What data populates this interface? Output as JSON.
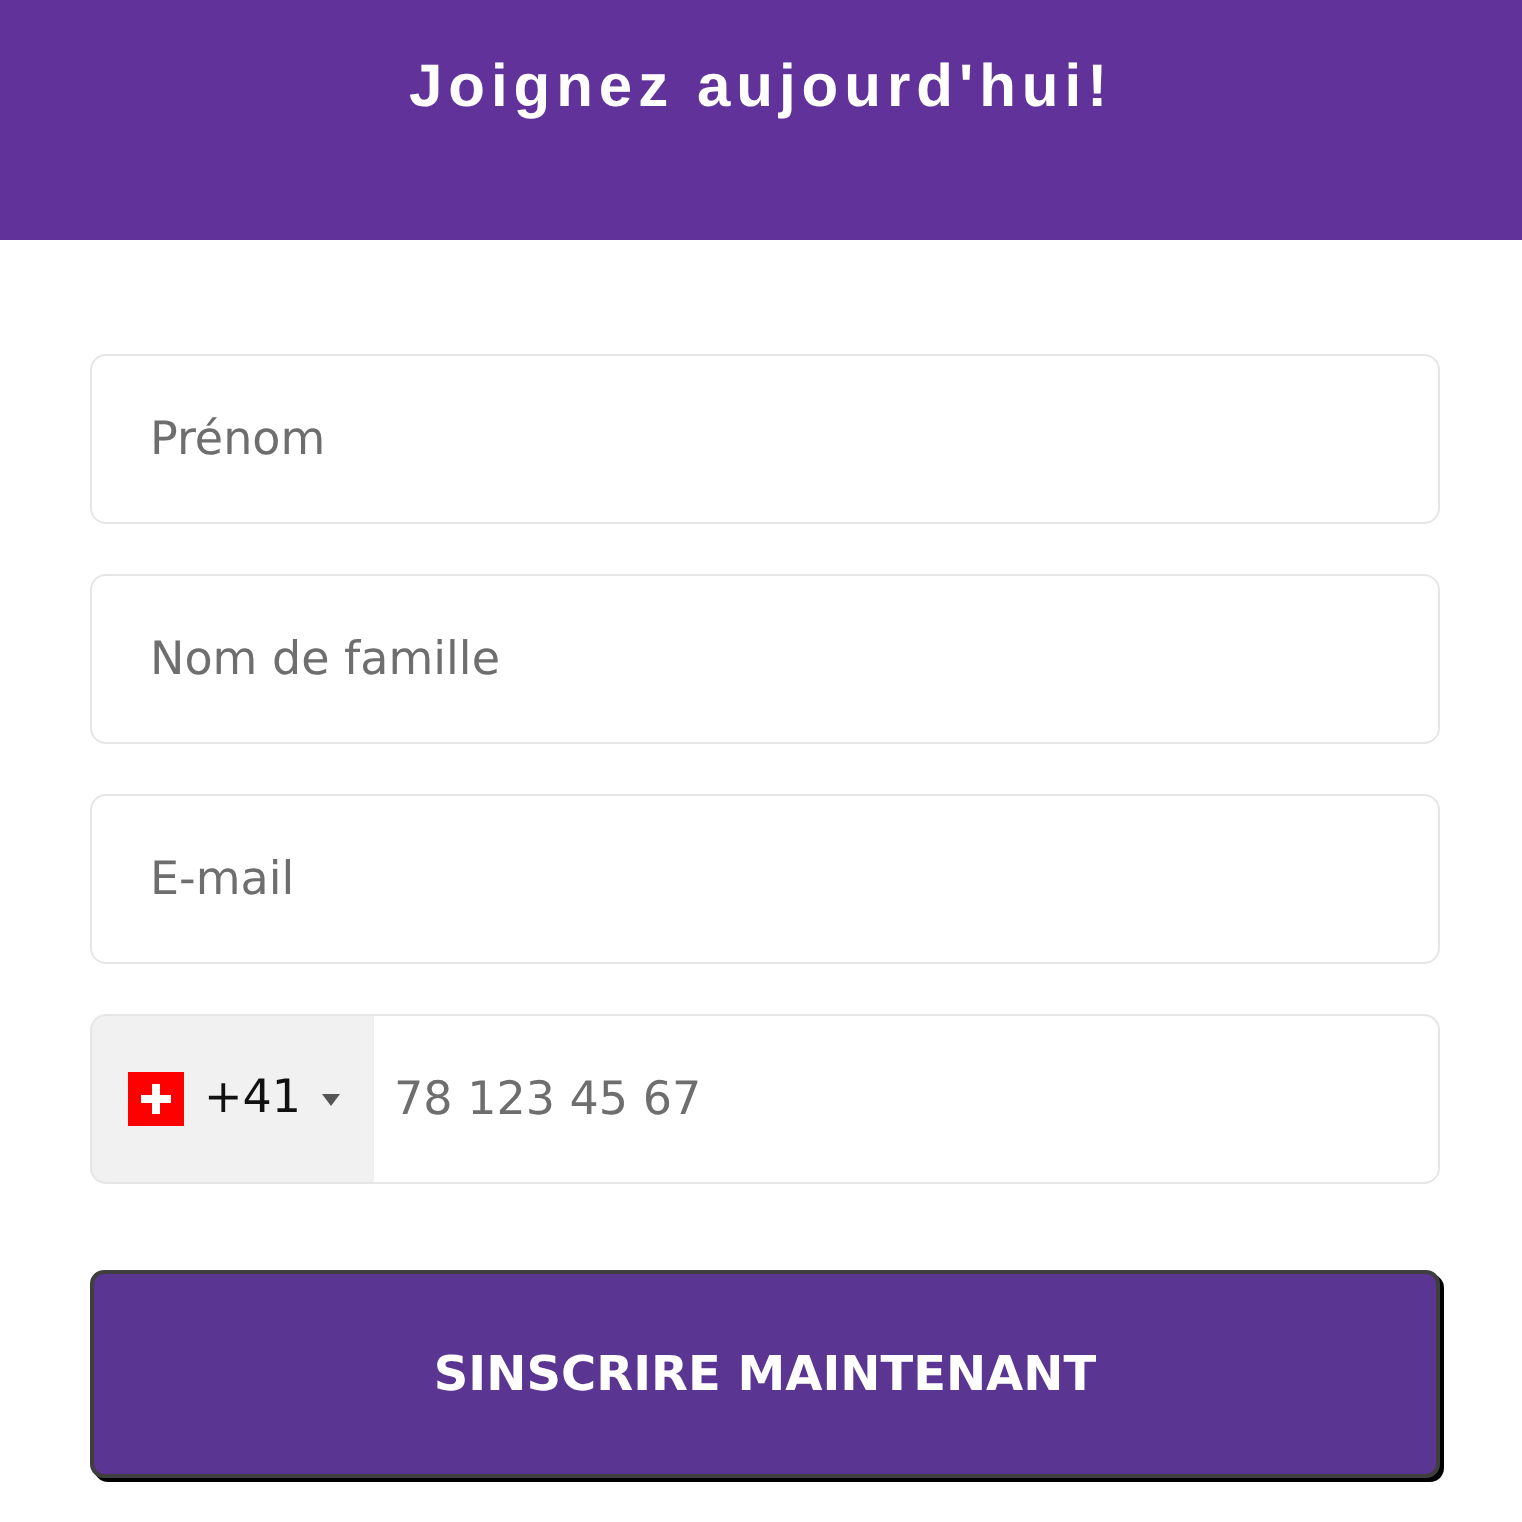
{
  "header": {
    "title": "Joignez aujourd'hui!"
  },
  "fields": [
    {
      "kind": "text",
      "placeholder": "Prénom"
    },
    {
      "kind": "text",
      "placeholder": "Nom de famille"
    },
    {
      "kind": "text",
      "placeholder": "E-mail"
    },
    {
      "kind": "phone",
      "country_code": "+41",
      "placeholder": "78 123 45 67"
    }
  ],
  "submit_button": {
    "label": "SINSCRIRE MAINTENANT"
  }
}
